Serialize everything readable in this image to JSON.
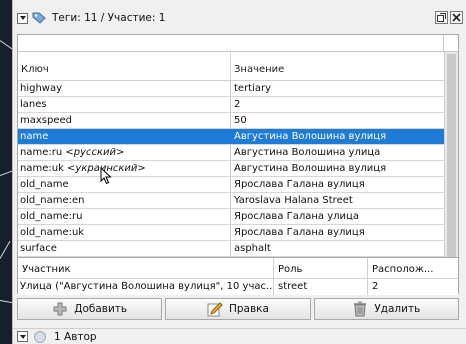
{
  "panel": {
    "title": "Теги: 11 / Участие: 1",
    "icon": "tag-icon"
  },
  "tags_table": {
    "columns": [
      "Ключ",
      "Значение"
    ],
    "rows": [
      {
        "key": "highway",
        "lang": "",
        "value": "tertiary",
        "selected": false
      },
      {
        "key": "lanes",
        "lang": "",
        "value": "2",
        "selected": false
      },
      {
        "key": "maxspeed",
        "lang": "",
        "value": "50",
        "selected": false
      },
      {
        "key": "name",
        "lang": "",
        "value": "Августина Волошина вулиця",
        "selected": true
      },
      {
        "key": "name:ru",
        "lang": "<русский>",
        "value": "Августина Волошина улица",
        "selected": false
      },
      {
        "key": "name:uk",
        "lang": "<украинский>",
        "value": "Августина Волошина вулиця",
        "selected": false
      },
      {
        "key": "old_name",
        "lang": "",
        "value": "Ярослава Галана вулиця",
        "selected": false
      },
      {
        "key": "old_name:en",
        "lang": "",
        "value": "Yaroslava Halana Street",
        "selected": false
      },
      {
        "key": "old_name:ru",
        "lang": "",
        "value": "Ярослава Галана улица",
        "selected": false
      },
      {
        "key": "old_name:uk",
        "lang": "",
        "value": "Ярослава Галана вулиця",
        "selected": false
      },
      {
        "key": "surface",
        "lang": "",
        "value": "asphalt",
        "selected": false
      }
    ]
  },
  "members_table": {
    "columns": [
      "Участник",
      "Роль",
      "Располож..."
    ],
    "rows": [
      {
        "member": "Улица (\"Августина Волошина вулиця\", 10 учас...",
        "role": "street",
        "position": "2"
      }
    ]
  },
  "toolbar": {
    "add_label": "Добавить",
    "edit_label": "Правка",
    "delete_label": "Удалить"
  },
  "bottom_panel": {
    "title": "1 Автор"
  },
  "colors": {
    "selection": "#1e7bd6",
    "background": "#f0f0f0"
  }
}
